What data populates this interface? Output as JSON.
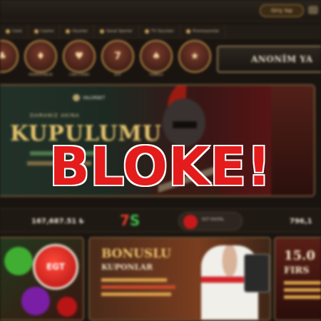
{
  "topbar": {
    "login_label": "Giriş Yap"
  },
  "nav": {
    "items": [
      {
        "label": "Canlı"
      },
      {
        "label": "Casino"
      },
      {
        "label": "Oyunlar"
      },
      {
        "label": "Sanal Sporlar"
      },
      {
        "label": "TV Oyunları"
      },
      {
        "label": "Promosyonlar"
      }
    ]
  },
  "categories": [
    {
      "glyph": "♣",
      "label": ""
    },
    {
      "glyph": "♦",
      "label": "PROMOSYONLAR"
    },
    {
      "glyph": "♥",
      "label": "CANLI CASINO"
    },
    {
      "glyph": "7",
      "label": "SLOT"
    },
    {
      "glyph": "♠",
      "label": "TOMBALA"
    },
    {
      "glyph": "★",
      "label": ""
    }
  ],
  "anon_banner": {
    "text": "ANONİM YA"
  },
  "hero": {
    "brand": "VALORBET",
    "kicker": "DAMANIZ AKINA",
    "headline": "KUPULUMU"
  },
  "balances": {
    "left": "167,687.51 ₺",
    "right": "796,1",
    "pill_text": "EGT DIGITAL",
    "logo": "7",
    "logo_accent": "S"
  },
  "cards": {
    "card1": {
      "logo": "EGT"
    },
    "card2": {
      "title": "BONUSLU",
      "subtitle": "KUPONLAR"
    },
    "card3": {
      "title": "15.0",
      "subtitle": "FIRS"
    }
  },
  "overlay": {
    "text": "BLOKE!"
  },
  "colors": {
    "overlay_red": "#e41c1c",
    "gold": "#e3c26d",
    "bg": "#1a1410"
  }
}
